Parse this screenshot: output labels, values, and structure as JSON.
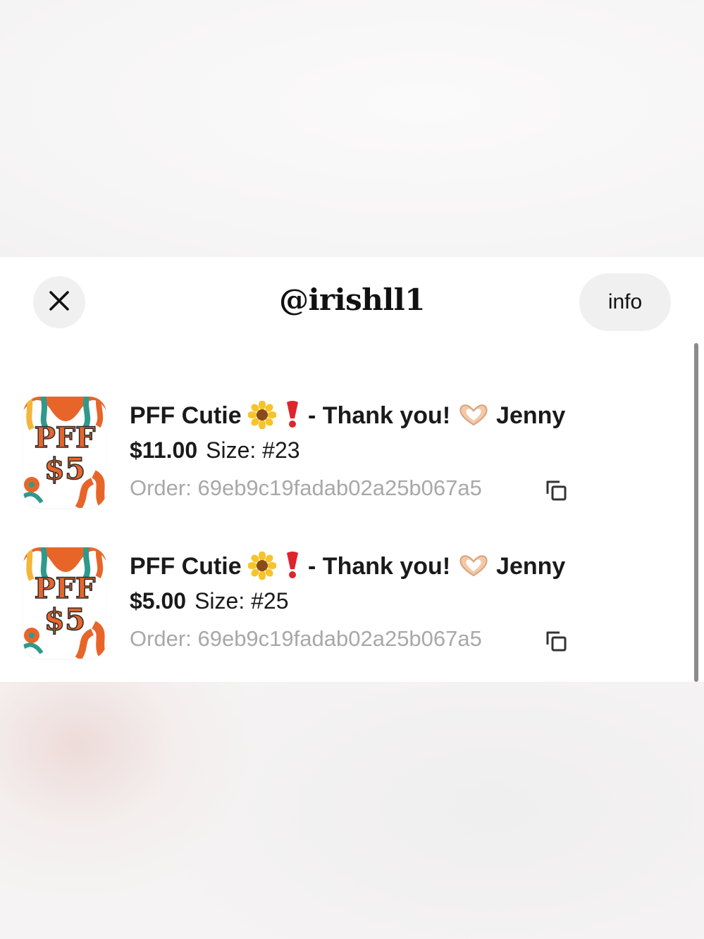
{
  "header": {
    "title": "@irishll1",
    "info_label": "info"
  },
  "icons": {
    "close": "close-icon",
    "copy": "copy-icon",
    "sunflower": "sunflower-emoji",
    "exclamation": "red-exclamation-emoji",
    "heart_hands": "heart-hands-emoji"
  },
  "colors": {
    "thumb_orange": "#e8652a",
    "thumb_teal": "#2f9a8a",
    "thumb_yellow": "#f4b63a",
    "order_text": "#a8a8a8"
  },
  "items": [
    {
      "thumb_text_1": "PFF",
      "thumb_text_2": "$5",
      "name_part1": "PFF Cutie",
      "name_part2": "- Thank you!",
      "name_part3": "Jenny",
      "price": "$11.00",
      "size": "Size: #23",
      "order": "Order: 69eb9c19fadab02a25b067a5"
    },
    {
      "thumb_text_1": "PFF",
      "thumb_text_2": "$5",
      "name_part1": "PFF Cutie",
      "name_part2": "- Thank you!",
      "name_part3": "Jenny",
      "price": "$5.00",
      "size": "Size: #25",
      "order": "Order: 69eb9c19fadab02a25b067a5"
    }
  ]
}
